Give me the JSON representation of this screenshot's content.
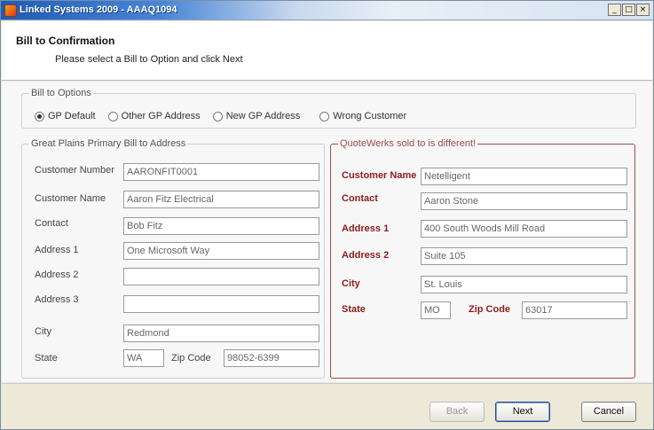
{
  "window": {
    "title": "Linked Systems 2009 - AAAQ1094",
    "controls": {
      "minimize": "_",
      "maximize": "□",
      "close": "×"
    }
  },
  "header": {
    "title": "Bill to Confirmation",
    "subtitle": "Please select a Bill to Option and click Next"
  },
  "bill_to_options": {
    "legend": "Bill to Options",
    "options": [
      {
        "label": "GP Default",
        "checked": true
      },
      {
        "label": "Other GP Address",
        "checked": false
      },
      {
        "label": "New GP Address",
        "checked": false
      },
      {
        "label": "Wrong Customer",
        "checked": false
      }
    ]
  },
  "gp_address": {
    "legend": "Great Plains Primary Bill to Address",
    "labels": {
      "customer_number": "Customer Number",
      "customer_name": "Customer Name",
      "contact": "Contact",
      "address1": "Address 1",
      "address2": "Address 2",
      "address3": "Address 3",
      "city": "City",
      "state": "State",
      "zip": "Zip Code"
    },
    "values": {
      "customer_number": "AARONFIT0001",
      "customer_name": "Aaron Fitz Electrical",
      "contact": "Bob Fitz",
      "address1": "One Microsoft Way",
      "address2": "",
      "address3": "",
      "city": "Redmond",
      "state": "WA",
      "zip": "98052-6399"
    }
  },
  "quotewerks": {
    "legend": "QuoteWerks sold to is different!",
    "labels": {
      "customer_name": "Customer Name",
      "contact": "Contact",
      "address1": "Address 1",
      "address2": "Address 2",
      "city": "City",
      "state": "State",
      "zip": "Zip Code"
    },
    "values": {
      "customer_name": "Netelligent",
      "contact": "Aaron Stone",
      "address1": "400 South Woods Mill Road",
      "address2": "Suite 105",
      "city": "St. Louis",
      "state": "MO",
      "zip": "63017"
    }
  },
  "footer": {
    "back_label": "Back",
    "next_label": "Next",
    "cancel_label": "Cancel"
  }
}
